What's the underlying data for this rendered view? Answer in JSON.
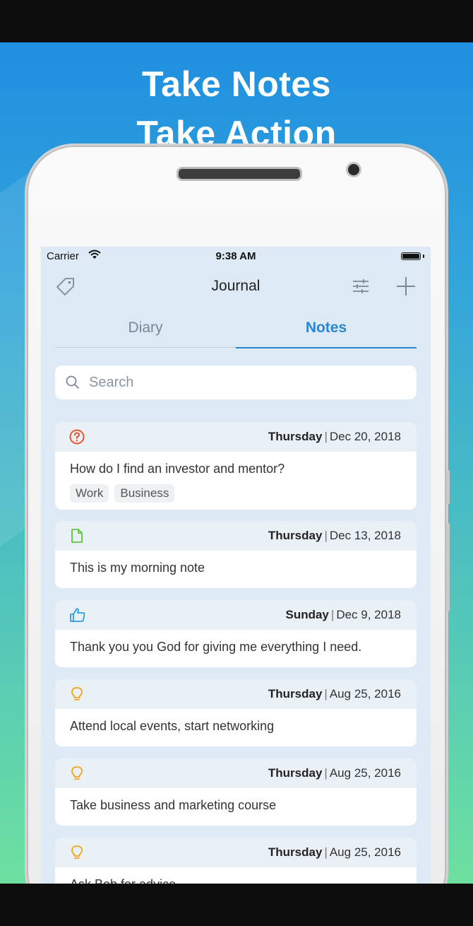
{
  "promo": {
    "headline_line1": "Take Notes",
    "headline_line2": "Take Action"
  },
  "status_bar": {
    "carrier": "Carrier",
    "time": "9:38 AM"
  },
  "navbar": {
    "title": "Journal",
    "left_icon": "tag-icon",
    "right_icons": [
      "filter-sliders-icon",
      "plus-icon"
    ]
  },
  "tabs": [
    {
      "label": "Diary",
      "selected": false
    },
    {
      "label": "Notes",
      "selected": true
    }
  ],
  "search": {
    "placeholder": "Search"
  },
  "colors": {
    "accent": "#2b86d0",
    "question": "#e8552e",
    "document": "#5cc43c",
    "thumbs_up": "#2b9fe0",
    "bulb": "#f2a31c"
  },
  "notes": [
    {
      "icon": "question-icon",
      "day": "Thursday",
      "date": "Dec 20, 2018",
      "text": "How do I find an investor and mentor?",
      "tags": [
        "Work",
        "Business"
      ]
    },
    {
      "icon": "document-icon",
      "day": "Thursday",
      "date": "Dec 13, 2018",
      "text": "This is my morning note"
    },
    {
      "icon": "thumbs-up-icon",
      "day": "Sunday",
      "date": "Dec 9, 2018",
      "text": "Thank you you God for giving me everything I need."
    },
    {
      "icon": "lightbulb-icon",
      "day": "Thursday",
      "date": "Aug 25, 2016",
      "text": "Attend local events, start networking"
    },
    {
      "icon": "lightbulb-icon",
      "day": "Thursday",
      "date": "Aug 25, 2016",
      "text": "Take business and marketing course"
    },
    {
      "icon": "lightbulb-icon",
      "day": "Thursday",
      "date": "Aug 25, 2016",
      "text": "Ask Bob for advice"
    }
  ]
}
